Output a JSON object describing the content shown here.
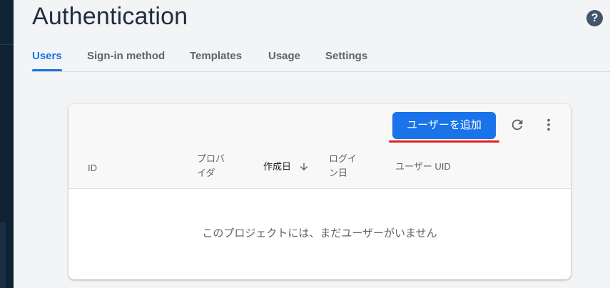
{
  "page": {
    "title": "Authentication"
  },
  "help": {
    "icon": "help-circle-icon",
    "glyph": "?"
  },
  "tabs": [
    {
      "label": "Users",
      "active": true
    },
    {
      "label": "Sign-in method",
      "active": false
    },
    {
      "label": "Templates",
      "active": false
    },
    {
      "label": "Usage",
      "active": false
    },
    {
      "label": "Settings",
      "active": false
    }
  ],
  "users_card": {
    "add_user_label": "ユーザーを追加",
    "refresh_icon": "refresh-icon",
    "more_icon": "more-vert-icon",
    "columns": {
      "id": "ID",
      "provider": "プロバイダ",
      "created": "作成日",
      "signed_in": "ログイン日",
      "uid": "ユーザー UID"
    },
    "sort_icon": "arrow-down-icon",
    "empty_message": "このプロジェクトには、まだユーザーがいません"
  },
  "colors": {
    "accent": "#1a73e8",
    "highlight_underline": "#e0201b",
    "rail": "#0f2233"
  }
}
